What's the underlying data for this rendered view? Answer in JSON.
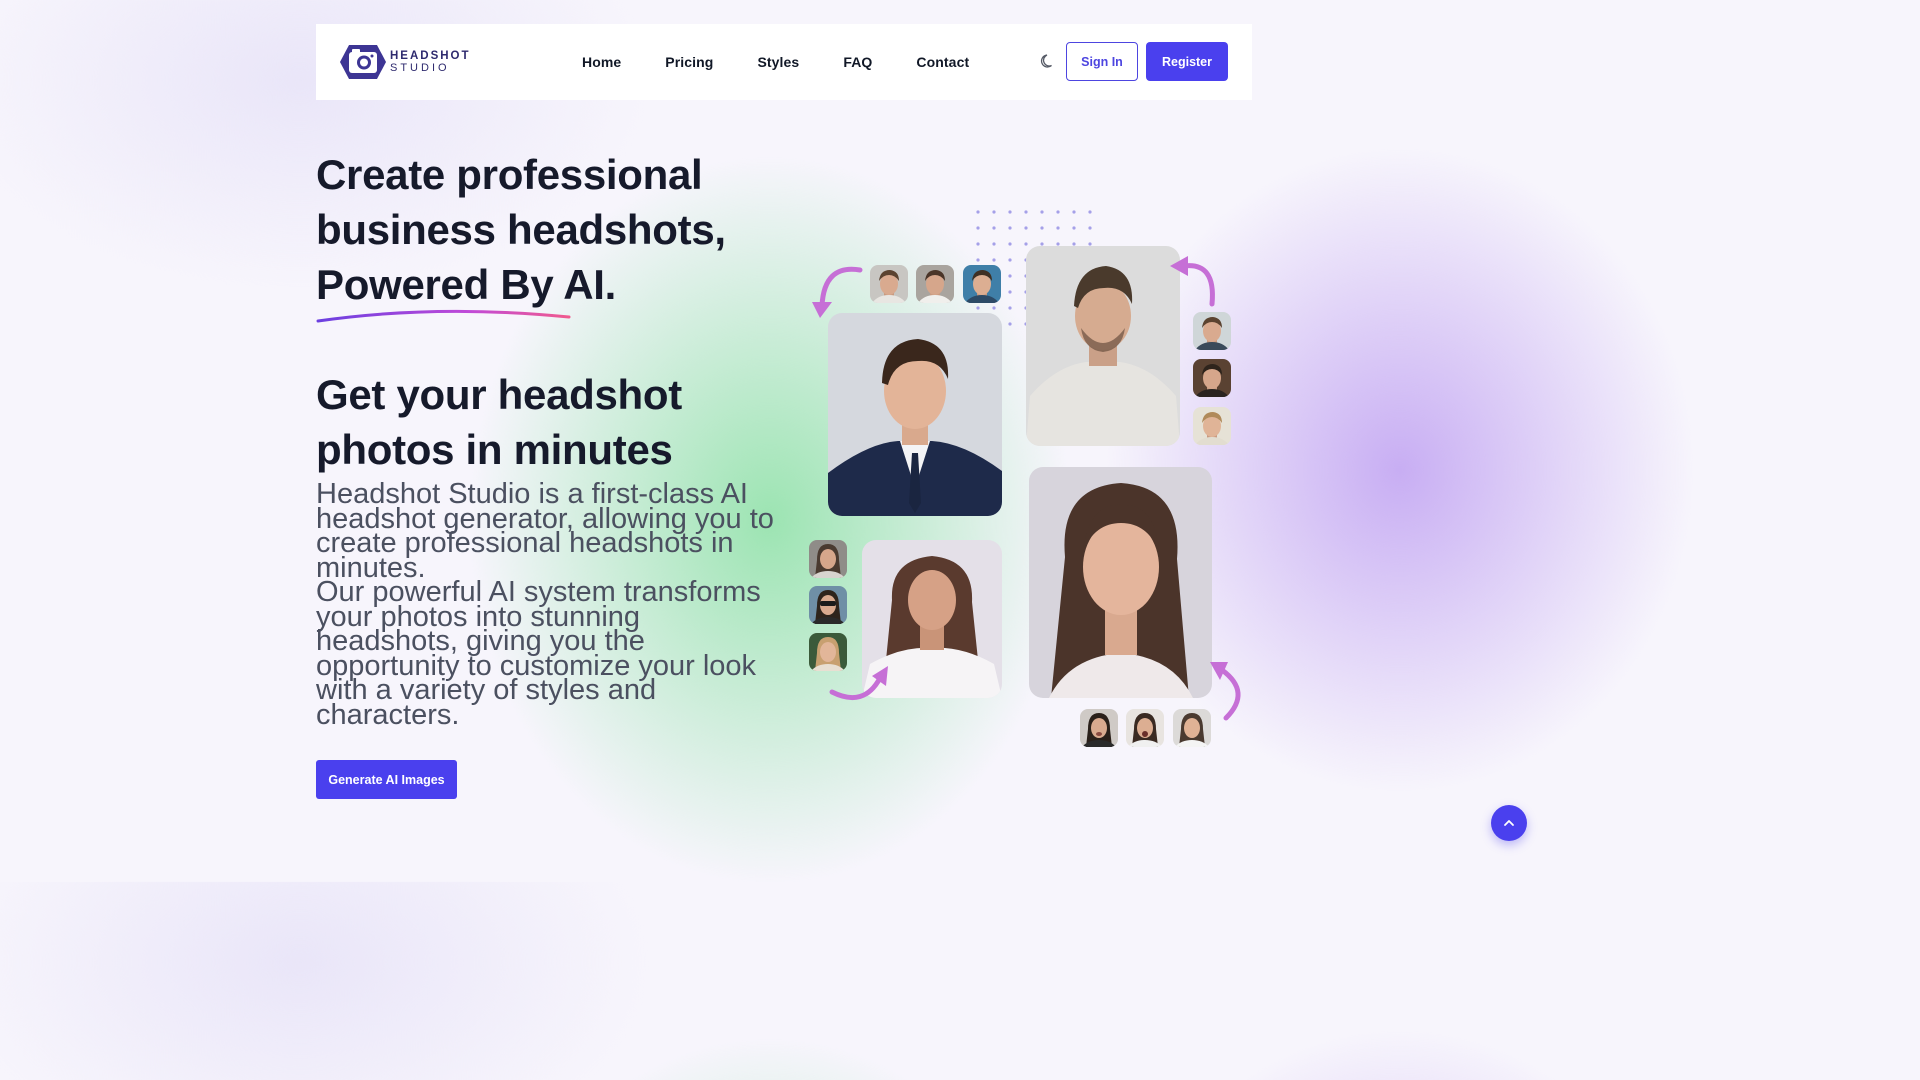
{
  "brand": {
    "line1": "HEADSHOT",
    "line2": "STUDIO",
    "icon": "camera-icon"
  },
  "nav": {
    "items": [
      "Home",
      "Pricing",
      "Styles",
      "FAQ",
      "Contact"
    ]
  },
  "header": {
    "theme_icon": "moon-icon",
    "signin_label": "Sign In",
    "register_label": "Register"
  },
  "hero": {
    "title_line1": "Create professional",
    "title_line2": "business headshots,",
    "title_line3": "Powered By AI.",
    "subtitle_line1": "Get your headshot",
    "subtitle_line2": "photos in minutes",
    "paragraph1": "Headshot Studio is a first-class AI headshot generator, allowing you to create professional headshots in minutes.",
    "paragraph2": "Our powerful AI system transforms your photos into stunning headshots, giving you the opportunity to customize your look with a variety of styles and characters.",
    "cta_label": "Generate AI Images"
  },
  "colors": {
    "accent": "#4a40ee",
    "arrow": "#c66fd6",
    "heading": "#161a2b",
    "text": "#4b5060"
  },
  "scroll_top_icon": "chevron-up-icon"
}
